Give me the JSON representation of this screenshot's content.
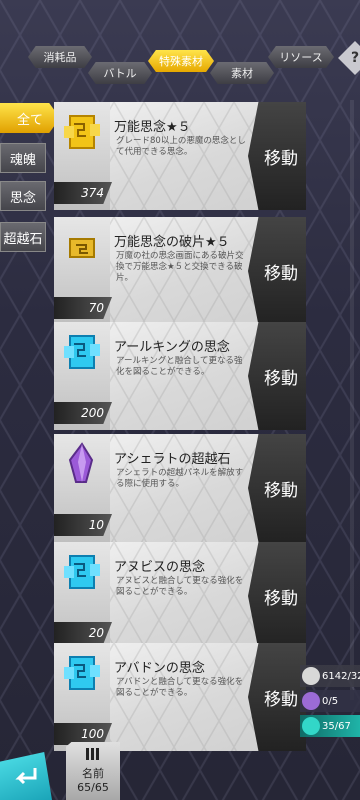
{
  "top_tabs": [
    {
      "label": "消耗品",
      "active": false
    },
    {
      "label": "バトル",
      "active": false
    },
    {
      "label": "特殊素材",
      "active": true
    },
    {
      "label": "素材",
      "active": false
    },
    {
      "label": "リソース",
      "active": false
    }
  ],
  "help_label": "?",
  "side_filters": [
    {
      "label": "全て",
      "active": true
    },
    {
      "label": "魂魄",
      "active": false
    },
    {
      "label": "思念",
      "active": false
    },
    {
      "label": "超越石",
      "active": false
    }
  ],
  "items": [
    {
      "title": "万能思念★５",
      "desc": "グレード80以上の悪魔の思念として代用できる思念。",
      "count": "374",
      "move_label": "移動",
      "icon": "gold-puzzle-icon"
    },
    {
      "title": "万能思念の破片★５",
      "desc": "万魔の社の思念画面にある破片交換で万能思念★５と交換できる破片。",
      "count": "70",
      "move_label": "移動",
      "icon": "gold-fragment-icon"
    },
    {
      "title": "アールキングの思念",
      "desc": "アールキングと融合して更なる強化を図ることができる。",
      "count": "200",
      "move_label": "移動",
      "icon": "blue-puzzle-icon"
    },
    {
      "title": "アシェラトの超越石",
      "desc": "アシェラトの超越パネルを解放する際に使用する。",
      "count": "10",
      "move_label": "移動",
      "icon": "purple-crystal-icon"
    },
    {
      "title": "アヌビスの思念",
      "desc": "アヌビスと融合して更なる強化を図ることができる。",
      "count": "20",
      "move_label": "移動",
      "icon": "blue-puzzle-icon"
    },
    {
      "title": "アバドンの思念",
      "desc": "アバドンと融合して更なる強化を図ることができる。",
      "count": "100",
      "move_label": "移動",
      "icon": "blue-puzzle-icon"
    }
  ],
  "bottom": {
    "sort_label": "名前",
    "capacity": "65/65"
  },
  "stats": [
    {
      "value": "6142/320",
      "icon": "stamina-run-icon",
      "color": "#d8d8d8"
    },
    {
      "value": "0/5",
      "icon": "demon-icon",
      "color": "#9b6bd6"
    },
    {
      "value": "35/67",
      "icon": "energy-icon",
      "color": "#32d7c8"
    }
  ]
}
